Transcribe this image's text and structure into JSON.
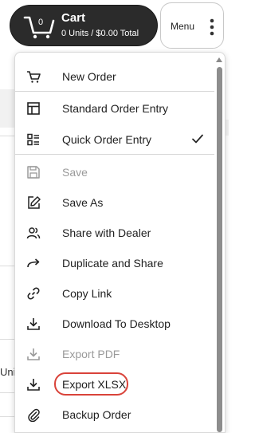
{
  "cart": {
    "title": "Cart",
    "count": "0",
    "summary": "0 Units / $0.00 Total"
  },
  "menu_button": {
    "label": "Menu"
  },
  "background": {
    "partial_text": "Uni"
  },
  "menu": {
    "items": [
      {
        "label": "New Order",
        "icon": "cart-icon",
        "disabled": false
      },
      {
        "label": "Standard Order Entry",
        "icon": "layout-icon",
        "disabled": false
      },
      {
        "label": "Quick Order Entry",
        "icon": "list-icon",
        "disabled": false,
        "checked": true
      },
      {
        "label": "Save",
        "icon": "save-icon",
        "disabled": true
      },
      {
        "label": "Save As",
        "icon": "edit-icon",
        "disabled": false
      },
      {
        "label": "Share with Dealer",
        "icon": "users-icon",
        "disabled": false
      },
      {
        "label": "Duplicate and Share",
        "icon": "share-arrow-icon",
        "disabled": false
      },
      {
        "label": "Copy Link",
        "icon": "link-icon",
        "disabled": false
      },
      {
        "label": "Download To Desktop",
        "icon": "download-icon",
        "disabled": false
      },
      {
        "label": "Export PDF",
        "icon": "download-icon",
        "disabled": true
      },
      {
        "label": "Export XLSX",
        "icon": "download-icon",
        "disabled": false,
        "highlighted": true,
        "highlight_color": "#d9433a"
      },
      {
        "label": "Backup Order",
        "icon": "paperclip-icon",
        "disabled": false
      }
    ]
  },
  "colors": {
    "cart_bg": "#2b2b2b",
    "disabled_text": "#9a9a9a",
    "highlight": "#d9433a"
  }
}
